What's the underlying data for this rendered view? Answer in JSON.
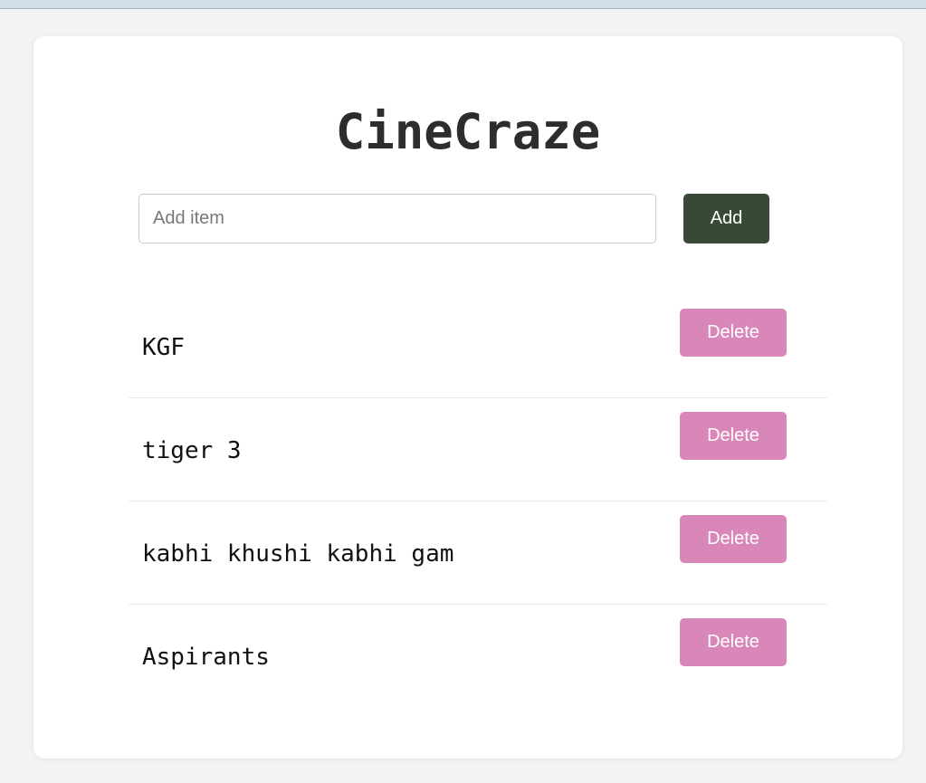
{
  "app": {
    "title": "CineCraze"
  },
  "form": {
    "input_value": "",
    "input_placeholder": "Add item",
    "add_label": "Add"
  },
  "items": [
    {
      "text": "KGF",
      "delete_label": "Delete"
    },
    {
      "text": "tiger 3",
      "delete_label": "Delete"
    },
    {
      "text": "kabhi khushi kabhi gam",
      "delete_label": "Delete"
    },
    {
      "text": "Aspirants",
      "delete_label": "Delete"
    }
  ],
  "colors": {
    "page_background": "#f3f3f3",
    "card_background": "#ffffff",
    "add_button": "#384a36",
    "delete_button": "#d987b8",
    "title_text": "#2d2d2d"
  }
}
